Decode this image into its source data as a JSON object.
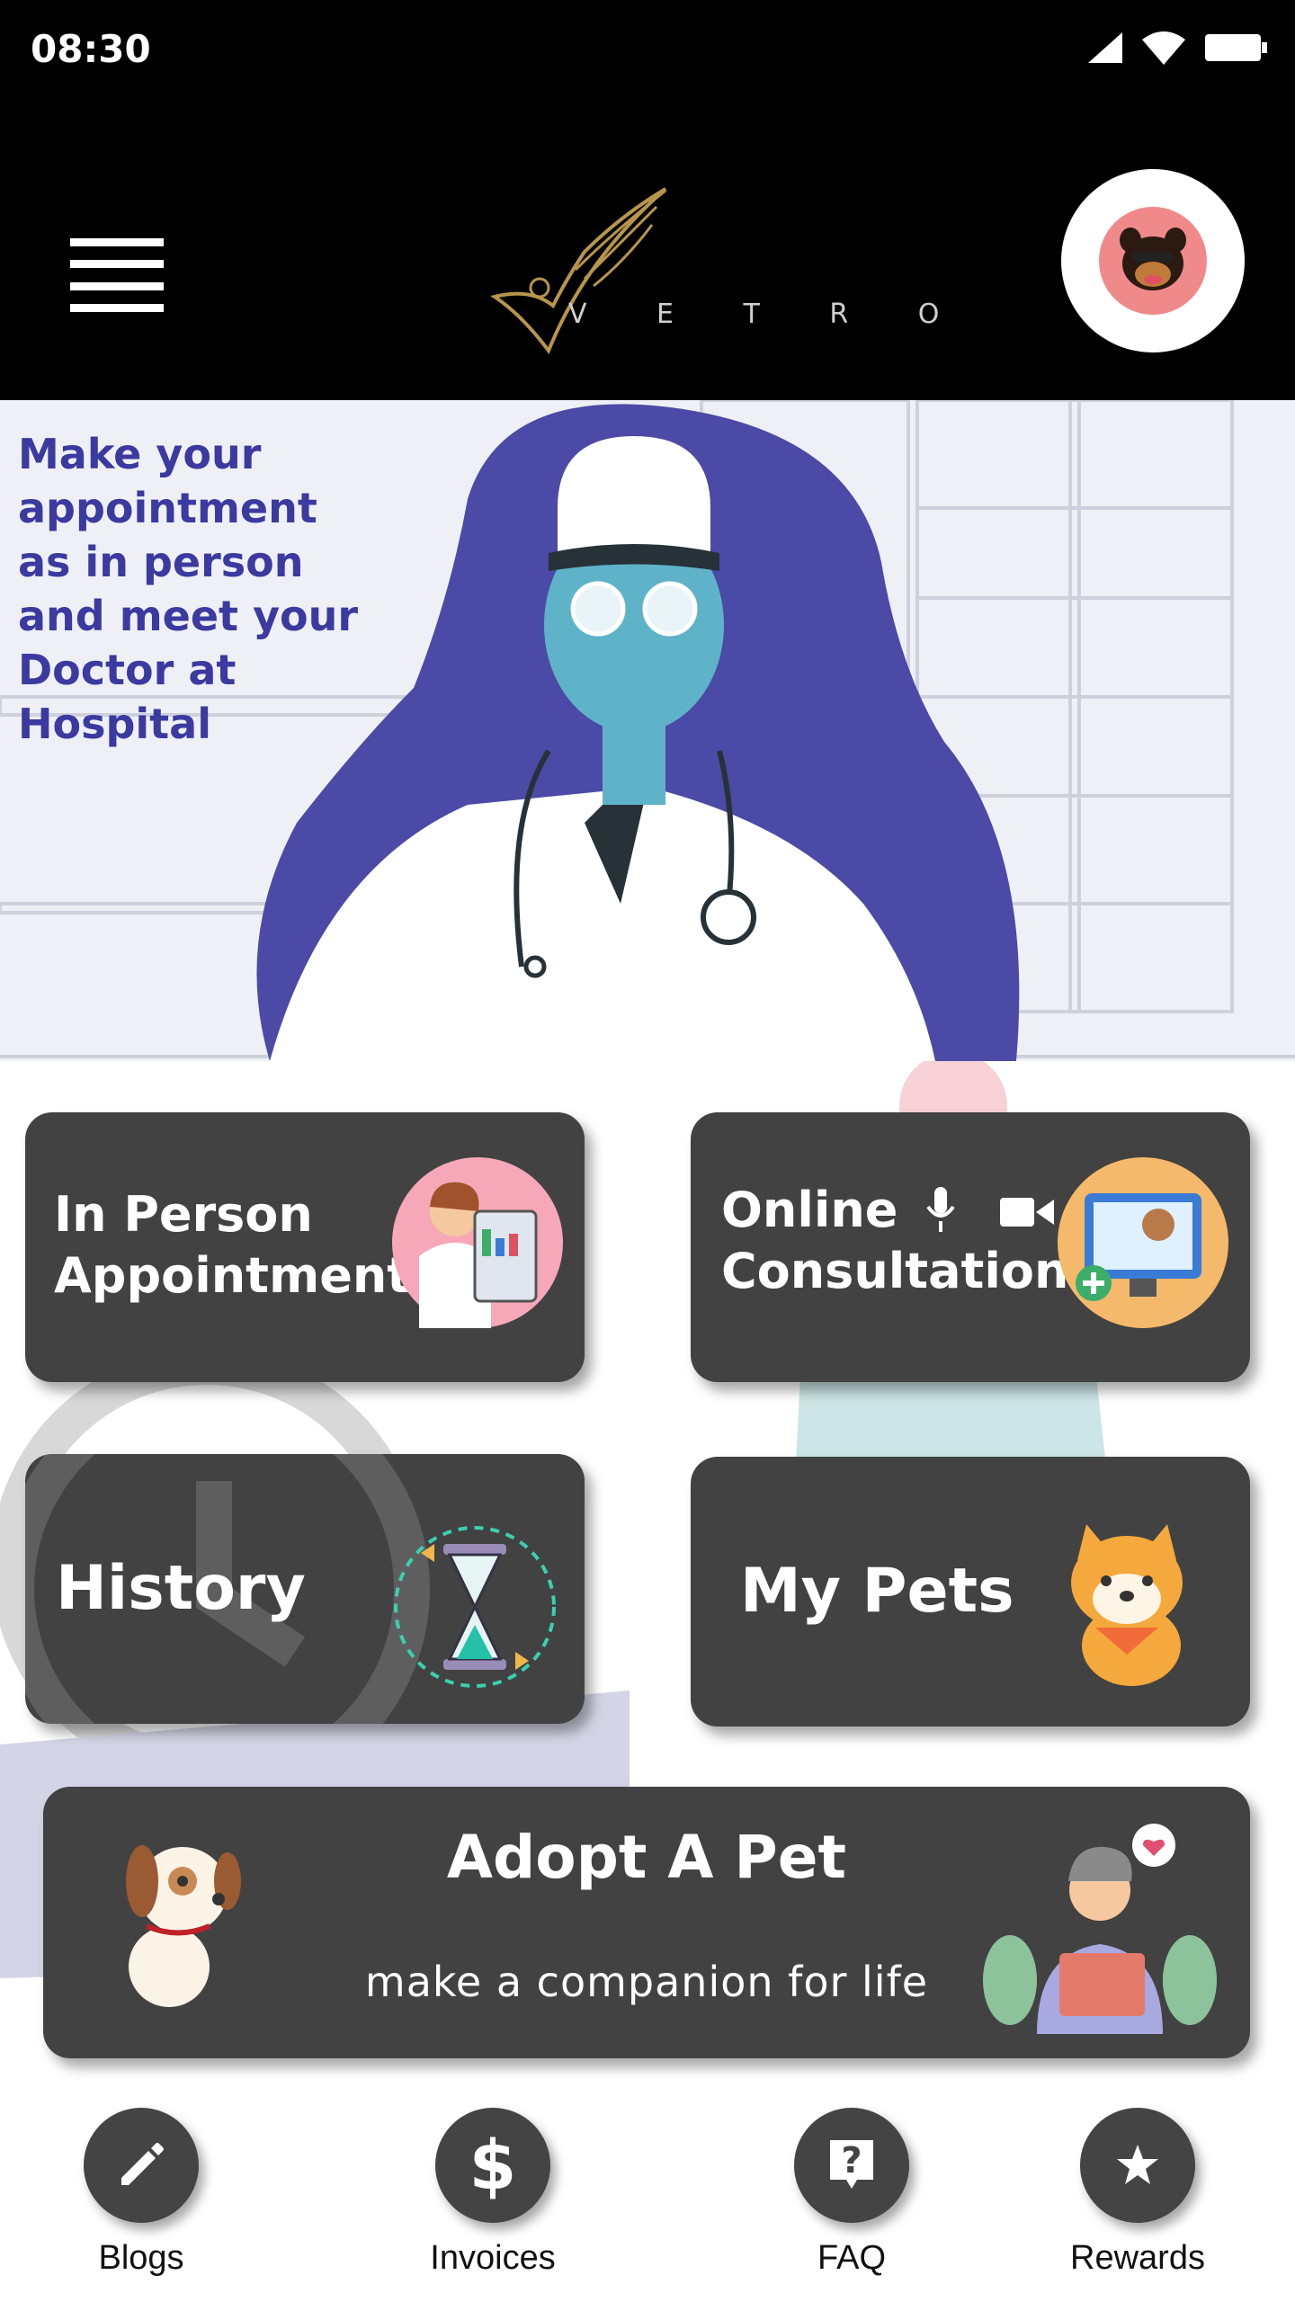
{
  "status_bar": {
    "time": "08:30"
  },
  "header": {
    "logo_text": "V E T R O"
  },
  "banner": {
    "lines": [
      "Make your appointment",
      "as in person",
      "and meet your",
      "Doctor at",
      "Hospital"
    ]
  },
  "cards": {
    "in_person": {
      "line1": "In Person",
      "line2": "Appointment"
    },
    "online": {
      "line1": "Online",
      "line2": "Consultation"
    },
    "history": {
      "label": "History"
    },
    "my_pets": {
      "label": "My Pets"
    },
    "adopt": {
      "title": "Adopt A Pet",
      "subtitle": "make a companion for life"
    }
  },
  "bottom_nav": [
    {
      "label": "Blogs",
      "icon": "pencil-icon"
    },
    {
      "label": "Invoices",
      "icon": "dollar-icon"
    },
    {
      "label": "FAQ",
      "icon": "question-icon"
    },
    {
      "label": "Rewards",
      "icon": "star-icon"
    }
  ],
  "colors": {
    "banner_text": "#3a3aa0",
    "card_bg": "#424242",
    "header_bg": "#000000"
  }
}
